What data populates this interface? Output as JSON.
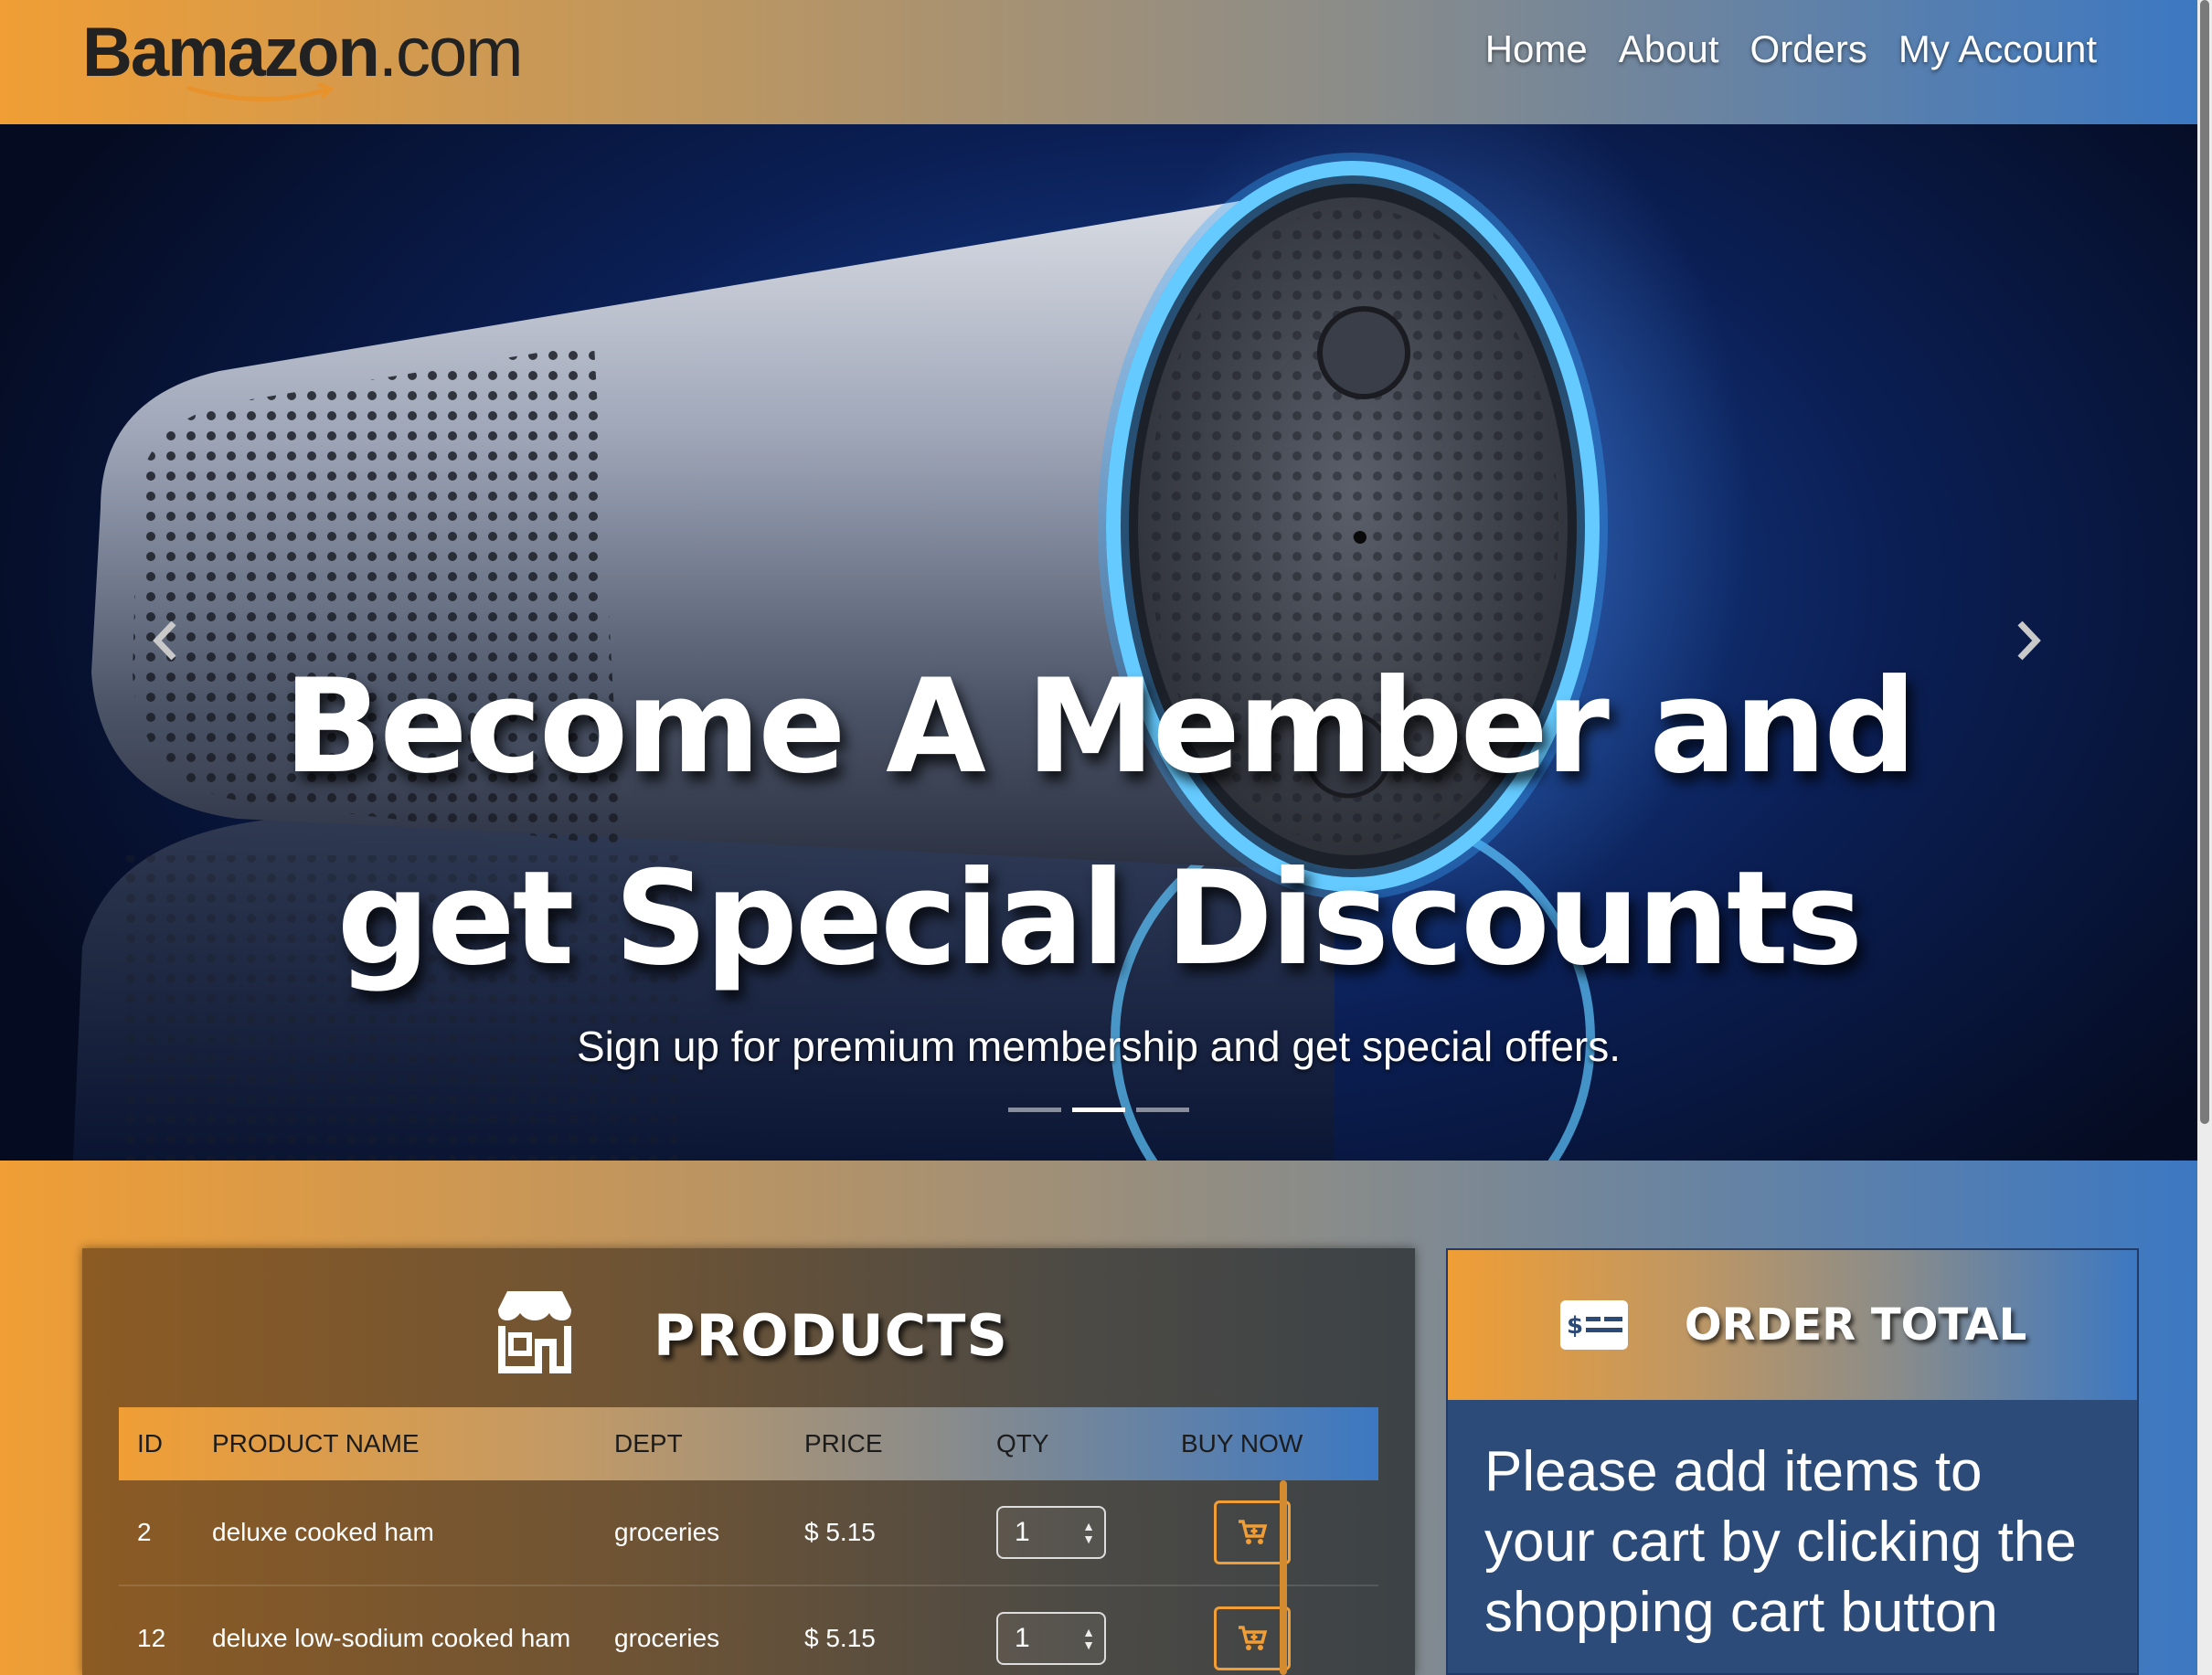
{
  "brand": {
    "name_bold": "Bamazon",
    "name_light": ".com"
  },
  "nav": {
    "items": [
      "Home",
      "About",
      "Orders",
      "My Account"
    ]
  },
  "hero": {
    "title_line1": "Become A Member and",
    "title_line2": "get Special Discounts",
    "subtitle": "Sign up for premium membership and get special offers.",
    "indicators": 3,
    "active_indicator": 1
  },
  "products": {
    "title": "PRODUCTS",
    "columns": {
      "id": "ID",
      "name": "PRODUCT NAME",
      "dept": "DEPT",
      "price": "PRICE",
      "qty": "QTY",
      "buy": "BUY NOW"
    },
    "rows": [
      {
        "id": "2",
        "name": "deluxe cooked ham",
        "dept": "groceries",
        "price": "$ 5.15",
        "qty": "1"
      },
      {
        "id": "12",
        "name": "deluxe low-sodium cooked ham",
        "dept": "groceries",
        "price": "$ 5.15",
        "qty": "1"
      }
    ]
  },
  "order": {
    "title": "ORDER TOTAL",
    "message": "Please add items to your cart by clicking the shopping cart button"
  },
  "colors": {
    "accent_orange": "#f09e35",
    "accent_blue": "#3c78c2"
  }
}
